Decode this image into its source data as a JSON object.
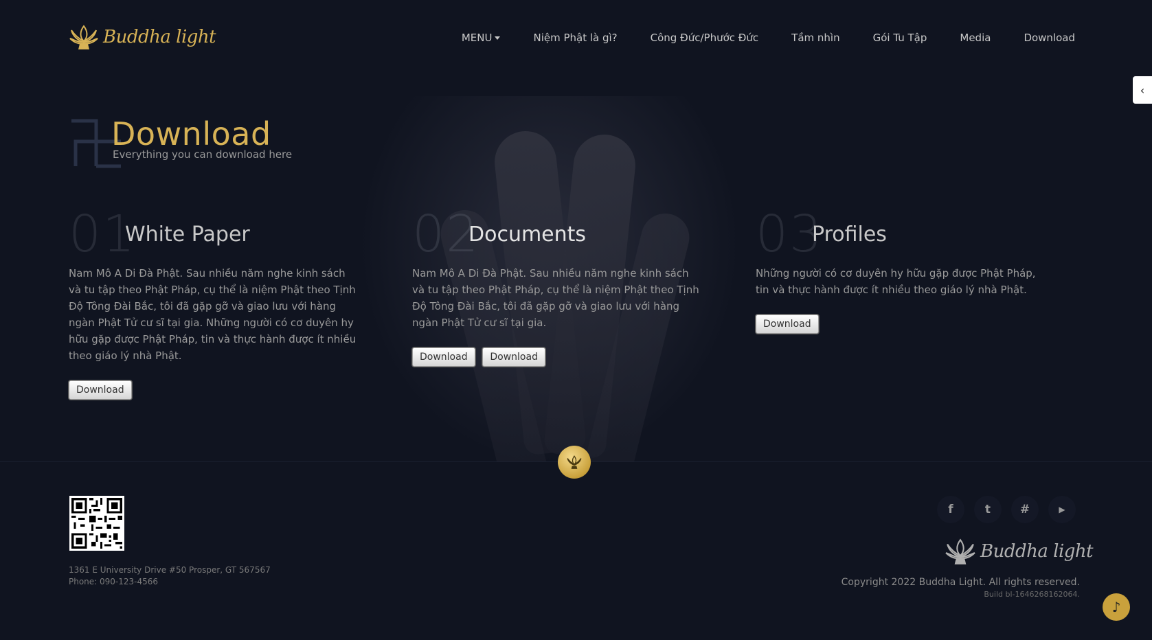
{
  "header": {
    "logo_text": "Buddha light",
    "nav": [
      {
        "label": "MENU"
      },
      {
        "label": "Niệm Phật là gì?"
      },
      {
        "label": "Công Đức/Phước Đức"
      },
      {
        "label": "Tầm nhìn"
      },
      {
        "label": "Gói Tu Tập"
      },
      {
        "label": "Media"
      },
      {
        "label": "Download"
      }
    ],
    "side_toggle_icon": "chevron-left-icon"
  },
  "hero": {
    "title": "Download",
    "subtitle": "Everything you can download here"
  },
  "sections": [
    {
      "number": "01",
      "title": "White Paper",
      "text": "Nam Mô A Di Đà Phật. Sau nhiều năm nghe kinh sách và tu tập theo Phật Pháp, cụ thể là niệm Phật theo Tịnh Độ Tông Đài Bắc, tôi đã gặp gỡ và giao lưu với hàng ngàn Phật Tử cư sĩ tại gia. Những người có cơ duyên hy hữu gặp được Phật Pháp, tin và thực hành được ít nhiều theo giáo lý nhà Phật.",
      "buttons": [
        "Download"
      ]
    },
    {
      "number": "02",
      "title": "Documents",
      "text": "Nam Mô A Di Đà Phật. Sau nhiều năm nghe kinh sách và tu tập theo Phật Pháp, cụ thể là niệm Phật theo Tịnh Độ Tông Đài Bắc, tôi đã gặp gỡ và giao lưu với hàng ngàn Phật Tử cư sĩ tại gia.",
      "buttons": [
        "Download",
        "Download"
      ]
    },
    {
      "number": "03",
      "title": "Profiles",
      "text": "Những người có cơ duyên hy hữu gặp được Phật Pháp, tin và thực hành được ít nhiều theo giáo lý nhà Phật.",
      "buttons": [
        "Download"
      ]
    }
  ],
  "footer": {
    "address": "1361 E University Drive #50 Prosper, GT 567567",
    "phone": "Phone: 090-123-4566",
    "socials": [
      {
        "icon": "facebook-icon",
        "glyph": "f"
      },
      {
        "icon": "twitter-icon",
        "glyph": "t"
      },
      {
        "icon": "hashtag-icon",
        "glyph": "#"
      },
      {
        "icon": "youtube-icon",
        "glyph": "▶"
      }
    ],
    "logo_text": "Buddha light",
    "copyright": "Copyright 2022 Buddha Light. All rights reserved.",
    "build": "Build bl-1646268162064."
  },
  "colors": {
    "background": "#101420",
    "accent_gold": "#d8b356"
  }
}
